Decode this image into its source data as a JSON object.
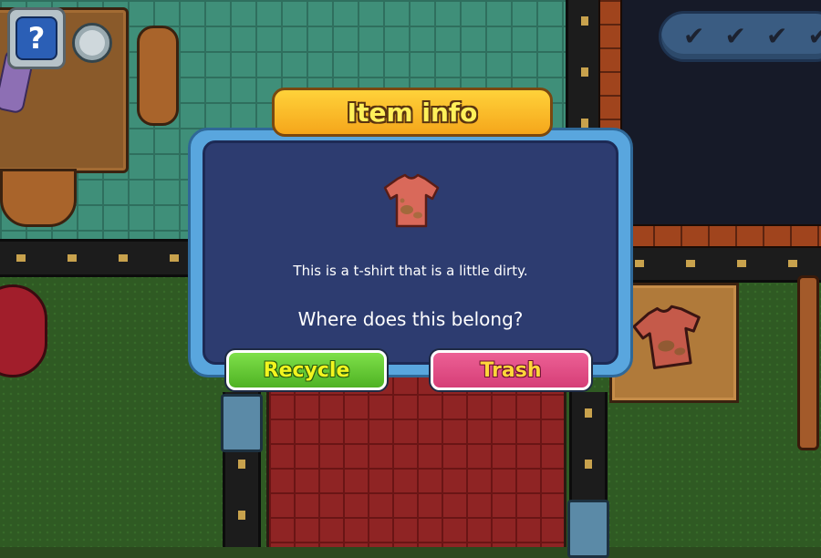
{
  "hud": {
    "help_label": "?",
    "help_icon": "question-mark-icon",
    "progress_checks": [
      "✔",
      "✔",
      "✔",
      "✔"
    ]
  },
  "dialog": {
    "title": "Item info",
    "item_icon": "dirty-tshirt-icon",
    "description": "This is a t-shirt that is a little dirty.",
    "question": "Where does this belong?",
    "buttons": {
      "recycle": "Recycle",
      "trash": "Trash"
    }
  },
  "colors": {
    "recycle": "#5cc52e",
    "trash": "#e04d83",
    "title_banner": "#f7b52a",
    "panel": "#2d3c70",
    "frame": "#59a6de"
  }
}
